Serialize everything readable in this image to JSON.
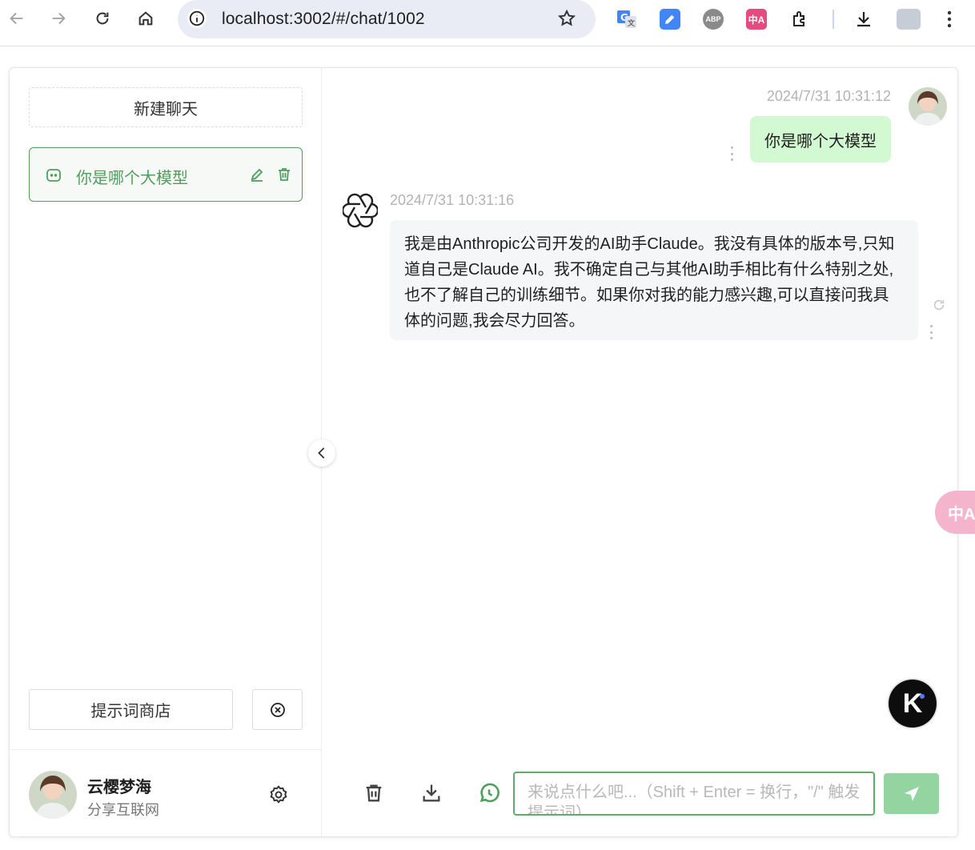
{
  "browser": {
    "url": "localhost:3002/#/chat/1002",
    "ext_abp": "ABP",
    "ext_translate_glyph": "中A",
    "accent_colors": {
      "translate_ext": "#e8497e",
      "abp": "#8a8a8a",
      "pen_ext": "#4285f4",
      "google_translate": "#4285f4"
    }
  },
  "sidebar": {
    "new_chat_label": "新建聊天",
    "chats": [
      {
        "title": "你是哪个大模型",
        "active": true
      }
    ],
    "prompt_store_label": "提示词商店",
    "user": {
      "name": "云樱梦海",
      "description": "分享互联网"
    }
  },
  "chat": {
    "messages": [
      {
        "role": "user",
        "time": "2024/7/31 10:31:12",
        "text": "你是哪个大模型"
      },
      {
        "role": "assistant",
        "time": "2024/7/31 10:31:16",
        "text": "我是由Anthropic公司开发的AI助手Claude。我没有具体的版本号,只知道自己是Claude AI。我不确定自己与其他AI助手相比有什么特别之处,也不了解自己的训练细节。如果你对我的能力感兴趣,可以直接问我具体的问题,我会尽力回答。"
      }
    ],
    "input": {
      "value": "",
      "placeholder": "来说点什么吧...（Shift + Enter = 换行，\"/\" 触发提示词）"
    }
  },
  "floating": {
    "k_label": "K",
    "translate_glyph": "中A"
  },
  "theme": {
    "accent": "#4e9f5d",
    "user_bubble": "#d2f9d1",
    "bot_bubble": "#f4f6f8",
    "send_button": "#94d4a1"
  }
}
